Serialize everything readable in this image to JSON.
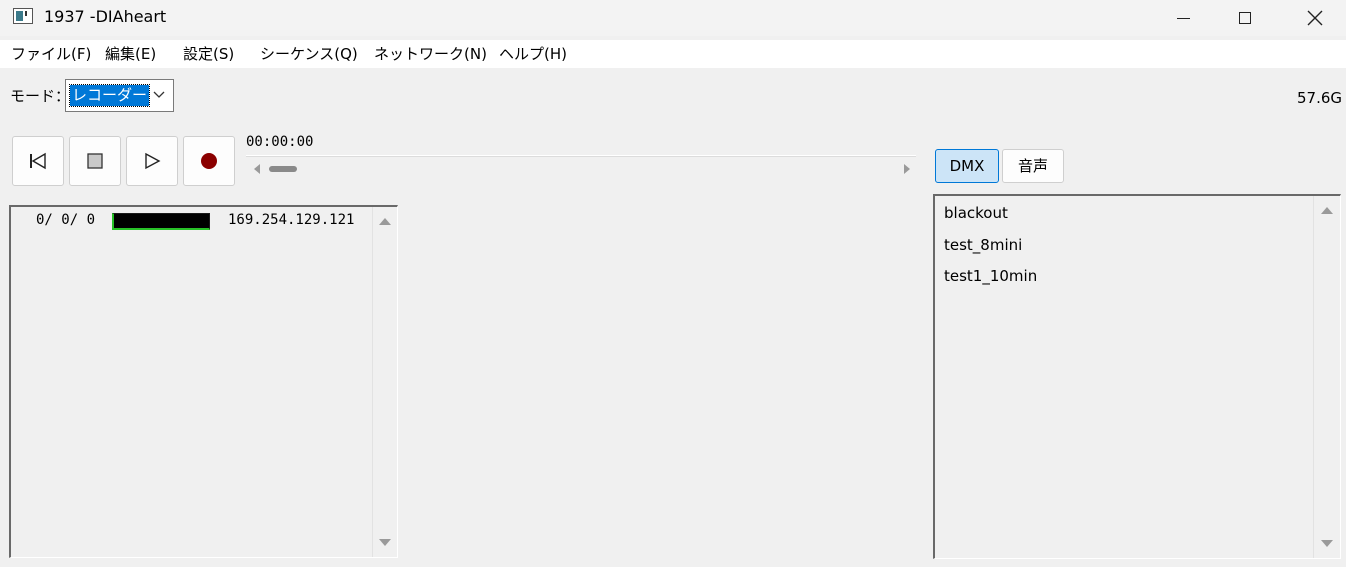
{
  "window": {
    "title": "1937 -DIAheart"
  },
  "menu": {
    "items": [
      "ファイル(F)",
      "編集(E)",
      "設定(S)",
      "シーケンス(Q)",
      "ネットワーク(N)",
      "ヘルプ(H)"
    ]
  },
  "mode": {
    "label": "モード：",
    "selected": "レコーダー"
  },
  "disk": {
    "free": "57.6G"
  },
  "transport": {
    "time": "00:00:00"
  },
  "status": {
    "counts": "0/ 0/ 0",
    "ip": "169.254.129.121"
  },
  "tabs": {
    "dmx": "DMX",
    "audio": "音声",
    "active": "DMX"
  },
  "sequences": [
    "blackout",
    "test_8mini",
    "test1_10min"
  ],
  "colors": {
    "accent": "#0078d7",
    "record": "#8b0000",
    "meter_green": "#27c227"
  }
}
